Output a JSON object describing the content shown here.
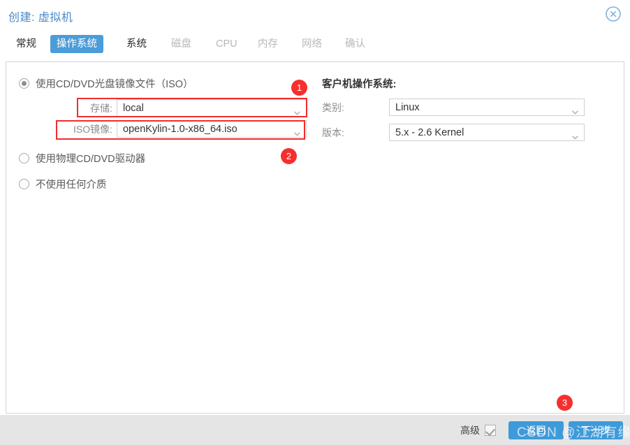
{
  "window": {
    "title": "创建: 虚拟机",
    "close_icon": "close-circle-icon"
  },
  "tabs": [
    {
      "label": "常规",
      "state": "enabled"
    },
    {
      "label": "操作系统",
      "state": "active"
    },
    {
      "label": "系统",
      "state": "enabled"
    },
    {
      "label": "磁盘",
      "state": "disabled"
    },
    {
      "label": "CPU",
      "state": "disabled"
    },
    {
      "label": "内存",
      "state": "disabled"
    },
    {
      "label": "网络",
      "state": "disabled"
    },
    {
      "label": "确认",
      "state": "disabled"
    }
  ],
  "media": {
    "options": [
      {
        "label": "使用CD/DVD光盘镜像文件（ISO）",
        "selected": true
      },
      {
        "label": "使用物理CD/DVD驱动器",
        "selected": false
      },
      {
        "label": "不使用任何介质",
        "selected": false
      }
    ],
    "fields": [
      {
        "label": "存储:",
        "value": "local"
      },
      {
        "label": "ISO镜像:",
        "value": "openKylin-1.0-x86_64.iso"
      }
    ]
  },
  "guest_os": {
    "heading": "客户机操作系统:",
    "fields": [
      {
        "label": "类别:",
        "value": "Linux"
      },
      {
        "label": "版本:",
        "value": "5.x - 2.6 Kernel"
      }
    ]
  },
  "annotations": {
    "badges": [
      "1",
      "2",
      "3"
    ],
    "highlight_color": "#ef2d2d"
  },
  "footer": {
    "advanced_label": "高级",
    "advanced_checked": true,
    "back_label": "返回",
    "next_label": "下一步"
  },
  "watermark": {
    "text": "CSDN @江湖有缘"
  },
  "colors": {
    "accent": "#4b9cd8",
    "title": "#4a89c8",
    "button": "#3e9ad8",
    "annotation": "#ef2d2d",
    "footer_bg": "#e5e5e5"
  }
}
